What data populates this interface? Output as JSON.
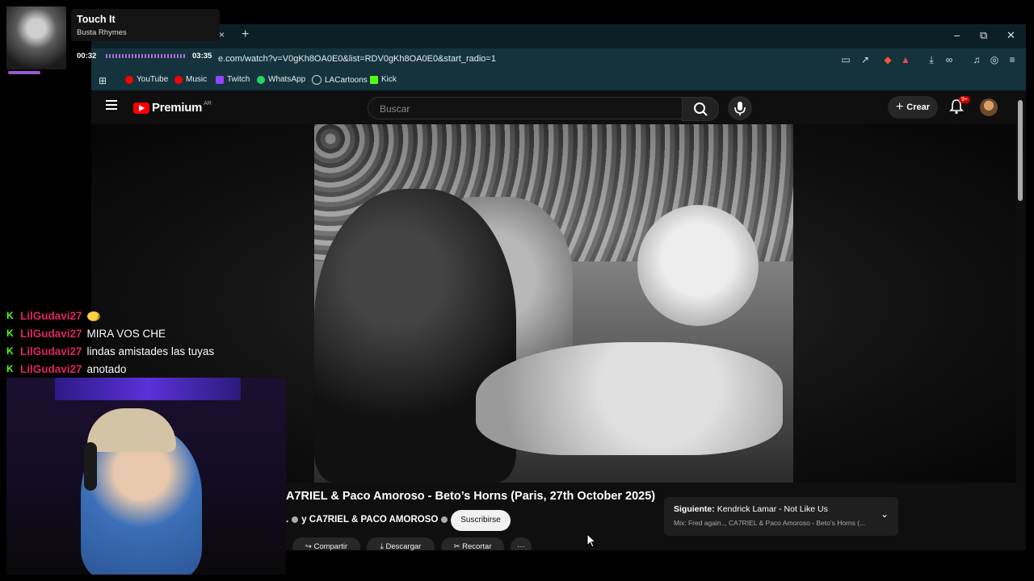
{
  "browser": {
    "tab_close": "×",
    "tab_new": "+",
    "url": "e.com/watch?v=V0gKh8OA0E0&list=RDV0gKh8OA0E0&start_radio=1",
    "window_controls": [
      "–",
      "⧉",
      "✕"
    ]
  },
  "bookmarks": [
    {
      "label": "YouTube",
      "color": "#ff0000"
    },
    {
      "label": "Music",
      "color": "#ff0000"
    },
    {
      "label": "Twitch",
      "color": "#9146ff"
    },
    {
      "label": "WhatsApp",
      "color": "#25d366"
    },
    {
      "label": "LACartoons",
      "color": "#cccccc"
    },
    {
      "label": "Kick",
      "color": "#53fc18"
    }
  ],
  "youtube": {
    "logo_text": "Premium",
    "region": "AR",
    "search_placeholder": "Buscar",
    "create_label": "Crear",
    "notifications_badge": "9+",
    "video_title": "A7RIEL & Paco Amoroso - Beto’s Horns (Paris, 27th October 2025)",
    "channel_line": ". ",
    "channel_line2": "y CA7RIEL & PACO AMOROSO",
    "subscribe_label": "Suscribirse",
    "actions": [
      "Compartir",
      "Descargar",
      "Recortar",
      "···"
    ],
    "next_prefix": "Siguiente:",
    "next_song": "Kendrick Lamar - Not Like Us",
    "next_mix": "Mix: Fred again.., CA7RIEL & Paco Amoroso - Beto’s Horns (..."
  },
  "music_widget": {
    "title": "Touch It",
    "artist": "Busta Rhymes",
    "elapsed": "00:32",
    "duration": "03:35",
    "progress_fraction": 0.15
  },
  "chat": [
    {
      "user": "LilGudavi27",
      "message": "",
      "emote": true
    },
    {
      "user": "LilGudavi27",
      "message": "MIRA VOS CHE",
      "emote": false
    },
    {
      "user": "LilGudavi27",
      "message": "lindas amistades las tuyas",
      "emote": false
    },
    {
      "user": "LilGudavi27",
      "message": "anotado",
      "emote": false
    }
  ]
}
